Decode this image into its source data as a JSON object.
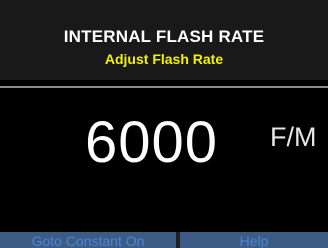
{
  "header": {
    "title": "INTERNAL FLASH RATE",
    "subtitle": "Adjust Flash Rate"
  },
  "display": {
    "value": "6000",
    "unit": "F/M"
  },
  "footer": {
    "left_button": "Goto Constant On",
    "right_button": "Help"
  },
  "colors": {
    "background": "#000000",
    "header_background": "#191919",
    "title": "#ffffff",
    "subtitle": "#f3f300",
    "button_background": "#3d5c85",
    "button_text": "#4b86d6"
  }
}
